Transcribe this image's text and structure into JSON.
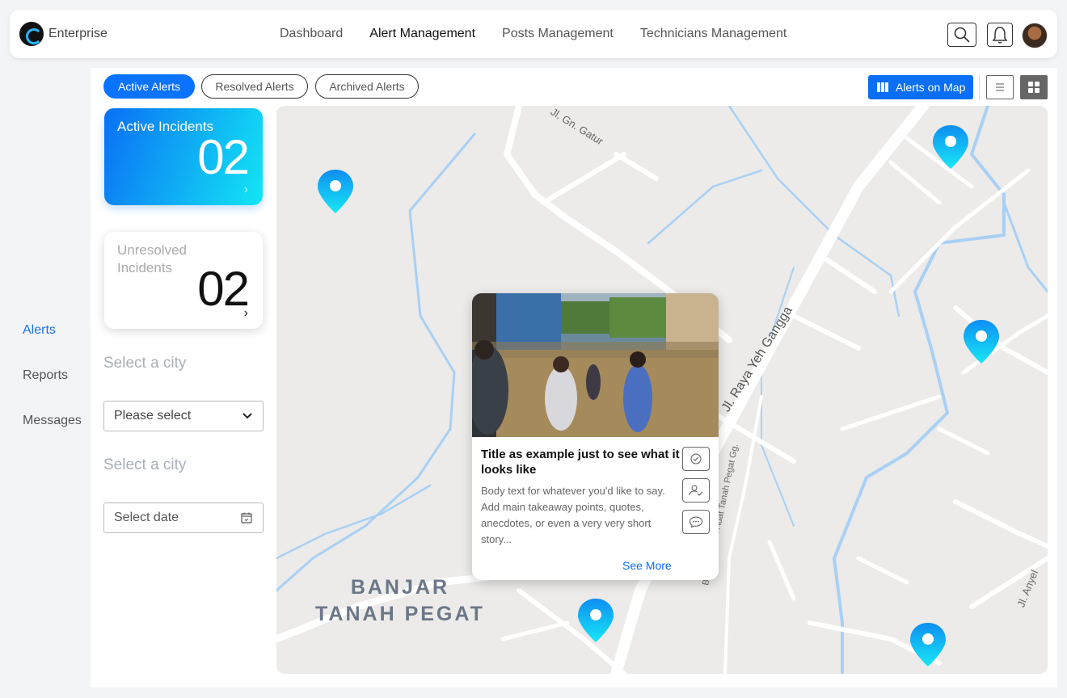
{
  "brand": {
    "name": "Enterprise"
  },
  "nav": {
    "items": [
      "Dashboard",
      "Alert Management",
      "Posts Management",
      "Technicians Management"
    ]
  },
  "sidebar": {
    "items": [
      "Alerts",
      "Reports",
      "Messages"
    ]
  },
  "tabs": [
    "Active Alerts",
    "Resolved Alerts",
    "Archived Alerts"
  ],
  "toolbar": {
    "map_view_label": "Alerts on Map"
  },
  "cards": {
    "active": {
      "title": "Active Incidents",
      "count": "02"
    },
    "unresolved": {
      "title": "Unresolved Incidents",
      "count": "02"
    }
  },
  "filters": {
    "city_label": "Select a city",
    "city_placeholder": "Please select",
    "date_label": "Select a city",
    "date_placeholder": "Select date"
  },
  "map": {
    "place_name_line1": "BANJAR",
    "place_name_line2": "TANAH PEGAT",
    "streets": [
      "Jl. Gn. Gatur",
      "Jl. Raya Yeh Gangga",
      "BR Pekraman Adat Tanah Pegat Gg.",
      "Jl. Anyel"
    ]
  },
  "popup": {
    "title": "Title as example just to see what it looks like",
    "body": "Body text for whatever you'd like to say. Add main takeaway points, quotes, anecdotes, or even a very very short story...",
    "link": "See More"
  },
  "colors": {
    "accent": "#0a73ff",
    "pin_top": "#0d9bf5",
    "pin_bottom": "#19e6f6"
  }
}
